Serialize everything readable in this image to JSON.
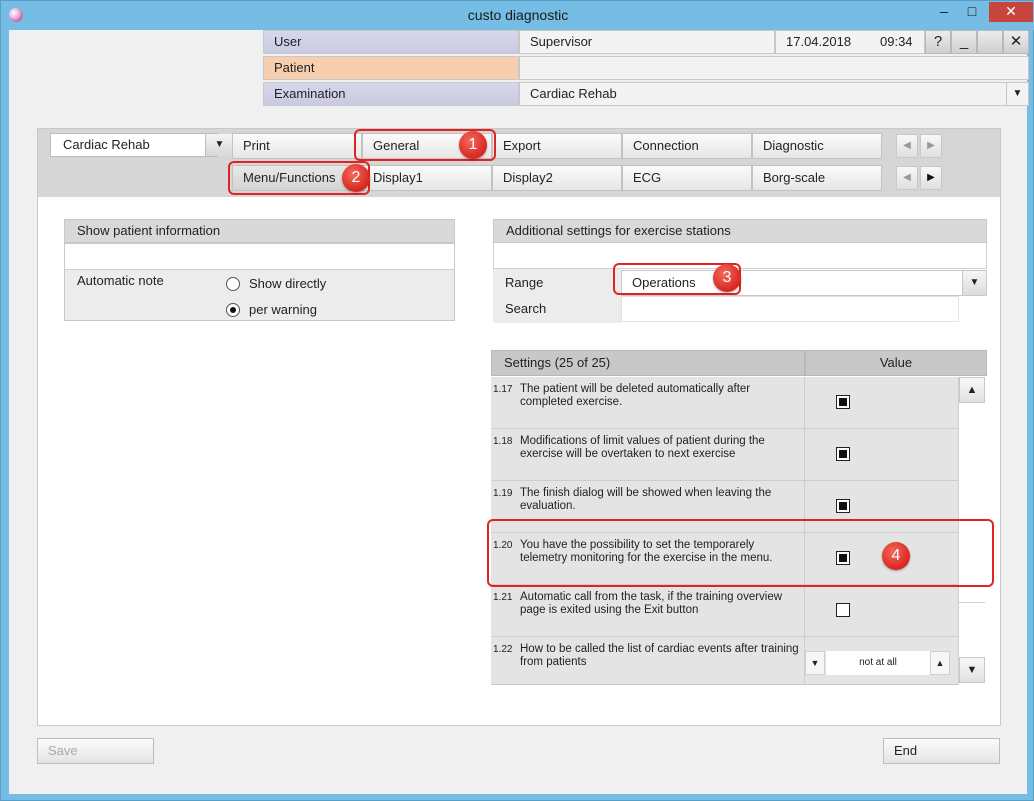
{
  "window": {
    "title": "custo diagnostic",
    "minimize_label": "–",
    "maximize_label": "□",
    "close_label": "✕"
  },
  "header": {
    "user_label": "User",
    "user_value": "Supervisor",
    "date": "17.04.2018",
    "time": "09:34",
    "help_label": "?",
    "min_label": "_",
    "blank_label": "",
    "close_label": "✕",
    "patient_label": "Patient",
    "patient_value": "",
    "examination_label": "Examination",
    "examination_value": "Cardiac Rehab",
    "dropdown_arrow": "▼"
  },
  "config": {
    "combo_value": "Cardiac Rehab",
    "combo_arrow": "▼",
    "tabs_row1": [
      "Print",
      "General",
      "Export",
      "Connection",
      "Diagnostic"
    ],
    "tabs_row2": [
      "Menu/Functions",
      "Display1",
      "Display2",
      "ECG",
      "Borg-scale"
    ],
    "nav_prev": "◀",
    "nav_next": "▶"
  },
  "patient_info": {
    "title": "Show patient information",
    "note_label": "Automatic note",
    "options": [
      {
        "label": "Show directly",
        "selected": false
      },
      {
        "label": "per warning",
        "selected": true
      }
    ]
  },
  "exercise": {
    "title": "Additional settings for exercise stations",
    "range_label": "Range",
    "range_value": "Operations",
    "range_arrow": "▼",
    "search_label": "Search",
    "search_value": "",
    "grid_settings_header": "Settings (25 of 25)",
    "grid_value_header": "Value",
    "rows": [
      {
        "num": "1.17",
        "text": "The patient will be deleted automatically after completed exercise.",
        "checked": true
      },
      {
        "num": "1.18",
        "text": "Modifications of limit values of patient during the exercise will be overtaken to next exercise",
        "checked": true
      },
      {
        "num": "1.19",
        "text": "The finish dialog will be showed when leaving the evaluation.",
        "checked": true
      },
      {
        "num": "1.20",
        "text": "You have the possibility to set the temporarely telemetry monitoring for the exercise in the menu.",
        "checked": true
      },
      {
        "num": "1.21",
        "text": "Automatic call from the task, if the training overview page is exited using the Exit button",
        "checked": false
      },
      {
        "num": "1.22",
        "text": "How to be called the list of cardiac events after training from patients",
        "spin_value": "not at all",
        "spin_down": "▼",
        "spin_up": "▲"
      }
    ],
    "scroll_up": "▲",
    "scroll_down": "▼"
  },
  "callouts": [
    "1",
    "2",
    "3",
    "4"
  ],
  "footer": {
    "save_label": "Save",
    "end_label": "End"
  },
  "colors": {
    "window_frame": "#76bde6",
    "close_button": "#c7453c",
    "patient_row": "#f8cfae",
    "callout_red": "#e02424"
  }
}
